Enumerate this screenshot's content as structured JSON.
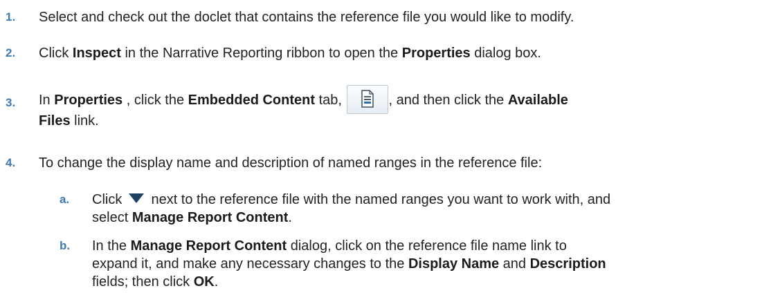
{
  "steps": [
    {
      "num": "1.",
      "t1": "Select and check out the doclet that contains the reference file you would like to modify."
    },
    {
      "num": "2.",
      "t1": "Click ",
      "b1": "Inspect",
      "t2": " in the Narrative Reporting ribbon to open the ",
      "b2": "Properties",
      "t3": " dialog box."
    },
    {
      "num": "3.",
      "t1": "In ",
      "b1": "Properties",
      "t2": " , click the ",
      "b2": "Embedded Content",
      "t3": " tab, ",
      "t4": ", and then click the ",
      "b3": "Available",
      "b4": "Files",
      "t5": " link."
    },
    {
      "num": "4.",
      "t1": "To change the display name and description of named ranges in the reference file:"
    }
  ],
  "substeps": [
    {
      "num": "a.",
      "t1": "Click ",
      "t2": " next to the reference file with the named ranges you want to work with, and",
      "t3": "select ",
      "b1": "Manage Report Content",
      "t4": "."
    },
    {
      "num": "b.",
      "t1": "In the ",
      "b1": "Manage Report Content",
      "t2": " dialog, click on the reference file name link to",
      "t3": "expand it, and make any necessary changes to the ",
      "b2": "Display Name",
      "t4": " and ",
      "b3": "Description",
      "t5": "fields; then click ",
      "b4": "OK",
      "t6": "."
    }
  ],
  "icons": {
    "embedded_content_tab": "document-list-icon",
    "menu_dropdown": "triangle-down-icon"
  },
  "colors": {
    "step_number": "#3f7ab5",
    "text": "#222222",
    "dropdown_triangle": "#1f3f63"
  }
}
